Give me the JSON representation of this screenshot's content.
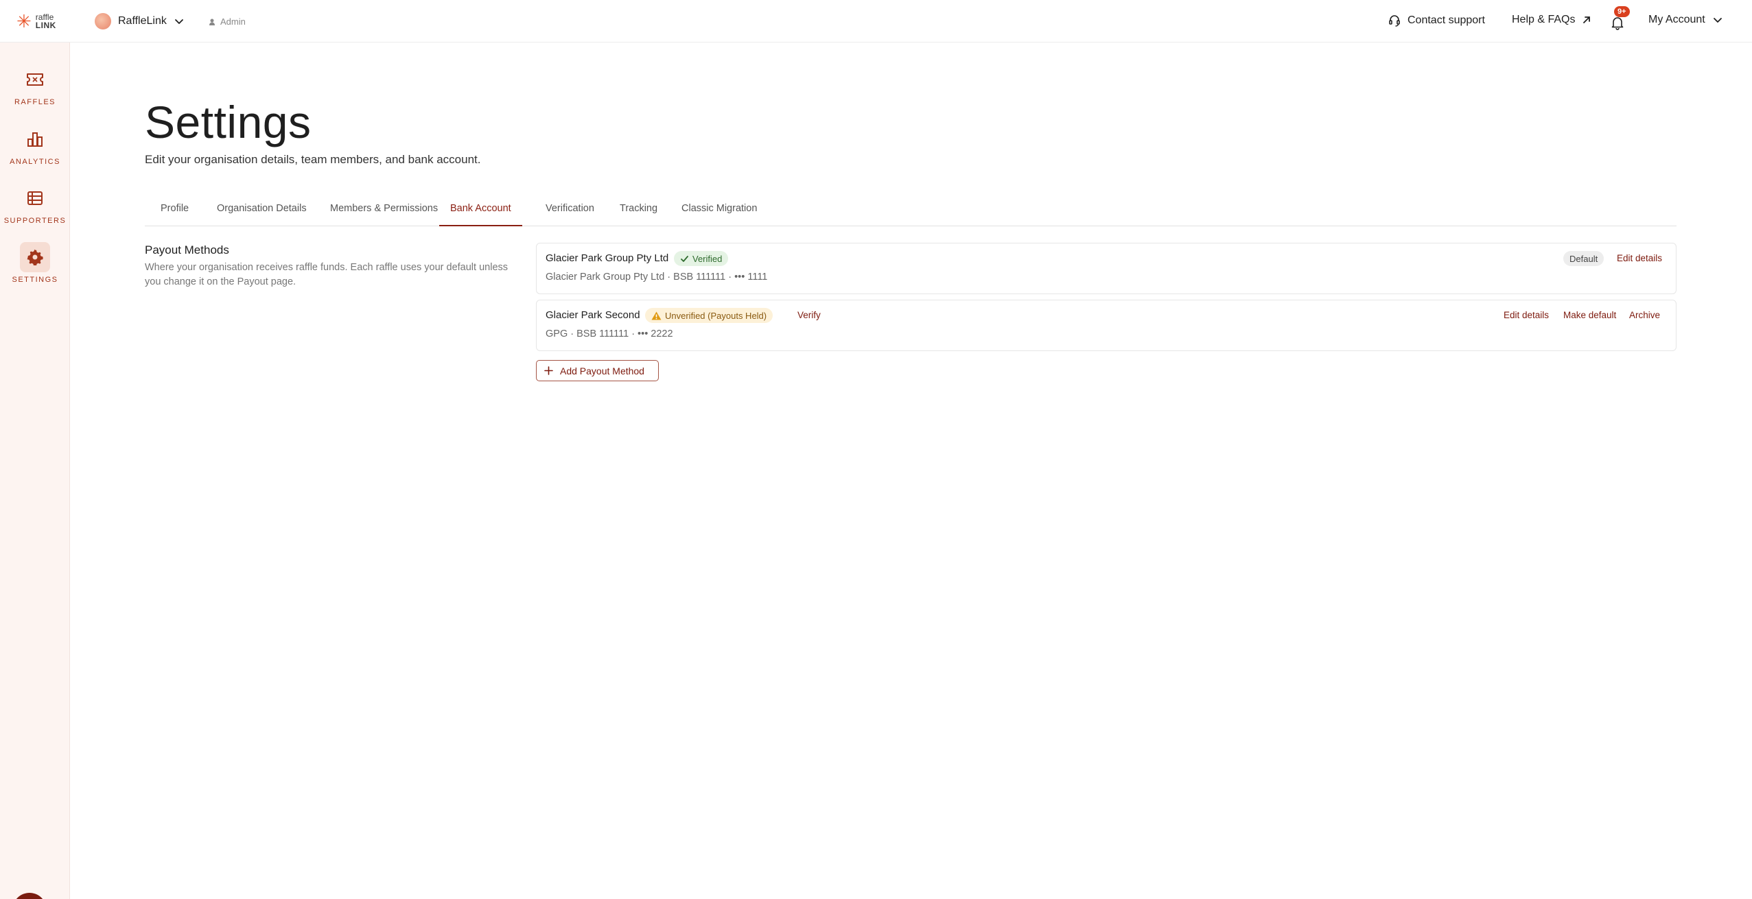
{
  "brand": {
    "logo_line1": "raffle",
    "logo_line2": "LINK"
  },
  "org": {
    "name": "RaffleLink",
    "role": "Admin"
  },
  "topnav": {
    "contact_label": "Contact support",
    "help_label": "Help & FAQs",
    "notifications_badge": "9+",
    "account_label": "My Account"
  },
  "sidebar": {
    "items": [
      {
        "label": "RAFFLES",
        "icon": "ticket-icon"
      },
      {
        "label": "ANALYTICS",
        "icon": "bar-chart-icon"
      },
      {
        "label": "SUPPORTERS",
        "icon": "list-icon"
      },
      {
        "label": "SETTINGS",
        "icon": "gear-icon",
        "active": true
      }
    ],
    "fab_icon": "asterisk-icon"
  },
  "page": {
    "title": "Settings",
    "subtitle": "Edit your organisation details, team members, and bank account."
  },
  "tabs": [
    {
      "label": "Profile"
    },
    {
      "label": "Organisation Details"
    },
    {
      "label": "Members & Permissions"
    },
    {
      "label": "Bank Account",
      "active": true
    },
    {
      "label": "Verification"
    },
    {
      "label": "Tracking"
    },
    {
      "label": "Classic Migration"
    }
  ],
  "payout": {
    "title": "Payout Methods",
    "description": "Where your organisation receives raffle funds. Each raffle uses your default unless you change it on the Payout page.",
    "methods": [
      {
        "name": "Glacier Park Group Pty Ltd",
        "status": "Verified",
        "details": "Glacier Park Group Pty Ltd · BSB 111111 · ••• 1111",
        "default_label": "Default",
        "edit_label": "Edit details"
      },
      {
        "name": "Glacier Park Second",
        "status": "Unverified (Payouts Held)",
        "verify_label": "Verify",
        "details": "GPG · BSB 111111 · ••• 2222",
        "edit_label": "Edit details",
        "make_default_label": "Make default",
        "archive_label": "Archive"
      }
    ],
    "add_label": "Add Payout Method"
  },
  "colors": {
    "accent": "#8a1f12",
    "sidebar_bg": "#fdf4f1",
    "brand_orange": "#e8542a",
    "verified_bg": "#e5f3e4",
    "unverified_bg": "#fdf1d8"
  }
}
